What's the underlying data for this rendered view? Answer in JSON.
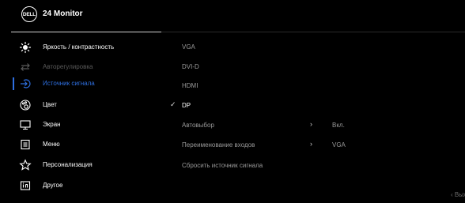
{
  "header": {
    "logo_text": "DELL",
    "title": "24 Monitor"
  },
  "menu": {
    "items": [
      {
        "label": "Яркость / контрастность",
        "icon": "brightness-icon",
        "state": "normal"
      },
      {
        "label": "Авторегулировка",
        "icon": "auto-adjust-icon",
        "state": "disabled"
      },
      {
        "label": "Источник сигнала",
        "icon": "input-source-icon",
        "state": "active"
      },
      {
        "label": "Цвет",
        "icon": "color-icon",
        "state": "normal"
      },
      {
        "label": "Экран",
        "icon": "display-icon",
        "state": "normal"
      },
      {
        "label": "Меню",
        "icon": "menu-icon",
        "state": "normal"
      },
      {
        "label": "Персонализация",
        "icon": "star-icon",
        "state": "normal"
      },
      {
        "label": "Другое",
        "icon": "info-icon",
        "state": "normal"
      }
    ]
  },
  "submenu": {
    "options": [
      {
        "label": "VGA",
        "selected": false
      },
      {
        "label": "DVI-D",
        "selected": false
      },
      {
        "label": "HDMI",
        "selected": false
      },
      {
        "label": "DP",
        "selected": true
      },
      {
        "label": "Автовыбор",
        "arrow": "›",
        "value": "Вкл."
      },
      {
        "label": "Переименование входов",
        "arrow": "›",
        "value": "VGA"
      },
      {
        "label": "Сбросить  источник сигнала"
      }
    ],
    "check_mark": "✓"
  },
  "footer": {
    "exit_label": "‹ Выход"
  },
  "colors": {
    "background": "#000000",
    "accent": "#2e6fe0",
    "disabled": "#5a5a5a",
    "option": "#9a9a9a"
  }
}
